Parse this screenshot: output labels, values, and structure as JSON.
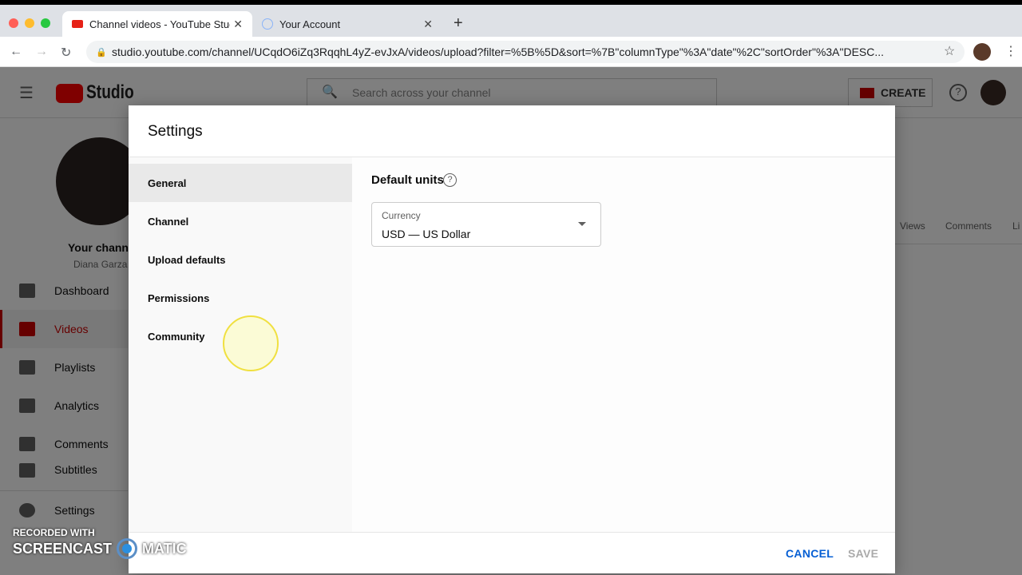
{
  "browser": {
    "tabs": [
      {
        "title": "Channel videos - YouTube Studio"
      },
      {
        "title": "Your Account"
      }
    ],
    "url": "studio.youtube.com/channel/UCqdO6iZq3RqqhL4yZ-evJxA/videos/upload?filter=%5B%5D&sort=%7B\"columnType\"%3A\"date\"%2C\"sortOrder\"%3A\"DESC..."
  },
  "app": {
    "logo": "Studio",
    "search_placeholder": "Search across your channel",
    "create": "CREATE",
    "channel_label": "Your channel",
    "channel_name": "Diana Garza",
    "nav": [
      {
        "label": "Dashboard"
      },
      {
        "label": "Videos"
      },
      {
        "label": "Playlists"
      },
      {
        "label": "Analytics"
      },
      {
        "label": "Comments"
      },
      {
        "label": "Subtitles"
      },
      {
        "label": "Settings"
      }
    ],
    "columns": [
      "Views",
      "Comments",
      "Li"
    ]
  },
  "dialog": {
    "title": "Settings",
    "menu": [
      {
        "label": "General"
      },
      {
        "label": "Channel"
      },
      {
        "label": "Upload defaults"
      },
      {
        "label": "Permissions"
      },
      {
        "label": "Community"
      }
    ],
    "section_title": "Default units",
    "currency_label": "Currency",
    "currency_value": "USD — US Dollar",
    "cancel": "CANCEL",
    "save": "SAVE"
  },
  "watermark": {
    "line1": "RECORDED WITH",
    "line2": "SCREENCAST",
    "line3": "MATIC"
  },
  "colors": {
    "accent": "#065fd4",
    "brand": "#ff0000"
  }
}
